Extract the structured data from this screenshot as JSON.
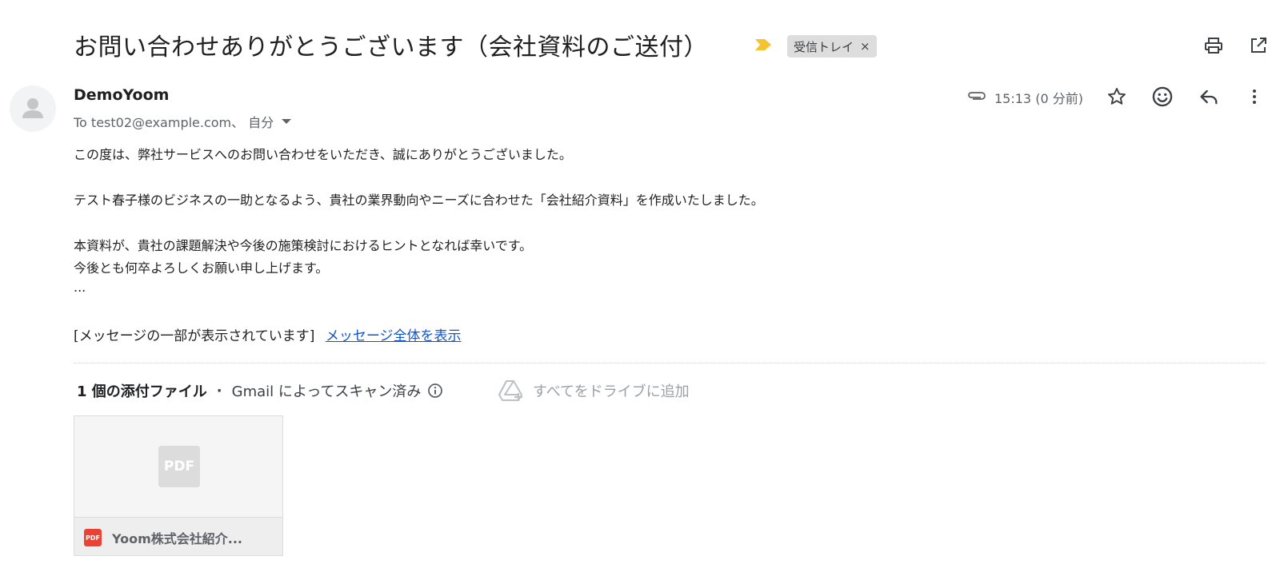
{
  "subject": "お問い合わせありがとうございます（会社資料のご送付）",
  "label": {
    "name": "受信トレイ",
    "remove": "×"
  },
  "sender": {
    "name": "DemoYoom",
    "recipients": "To test02@example.com、 自分"
  },
  "meta": {
    "time": "15:13 (0 分前)"
  },
  "body": {
    "lines": [
      "この度は、弊社サービスへのお問い合わせをいただき、誠にありがとうございました。",
      "テスト春子様のビジネスの一助となるよう、貴社の業界動向やニーズに合わせた「会社紹介資料」を作成いたしました。",
      "本資料が、貴社の課題解決や今後の施策検討におけるヒントとなれば幸いです。",
      "今後とも何卒よろしくお願い申し上げます。",
      "..."
    ],
    "trimmed_notice": "[メッセージの一部が表示されています]",
    "view_full_link": "メッセージ全体を表示"
  },
  "attachments": {
    "count_label": "1 個の添付ファイル",
    "scanned": "Gmail によってスキャン済み",
    "drive_button": "すべてをドライブに追加",
    "items": [
      {
        "name": "Yoom株式会社紹介...",
        "type": "PDF"
      }
    ]
  },
  "colors": {
    "link": "#1155cc",
    "importance": "#f4c430",
    "pdf_red": "#ea4335",
    "chip_bg": "#dddddd"
  },
  "icons": [
    "print-icon",
    "open-in-new-window-icon",
    "importance-marker-icon",
    "paperclip-icon",
    "star-icon",
    "emoji-icon",
    "reply-icon",
    "more-vert-icon",
    "info-icon",
    "add-to-drive-icon",
    "pdf-icon"
  ]
}
